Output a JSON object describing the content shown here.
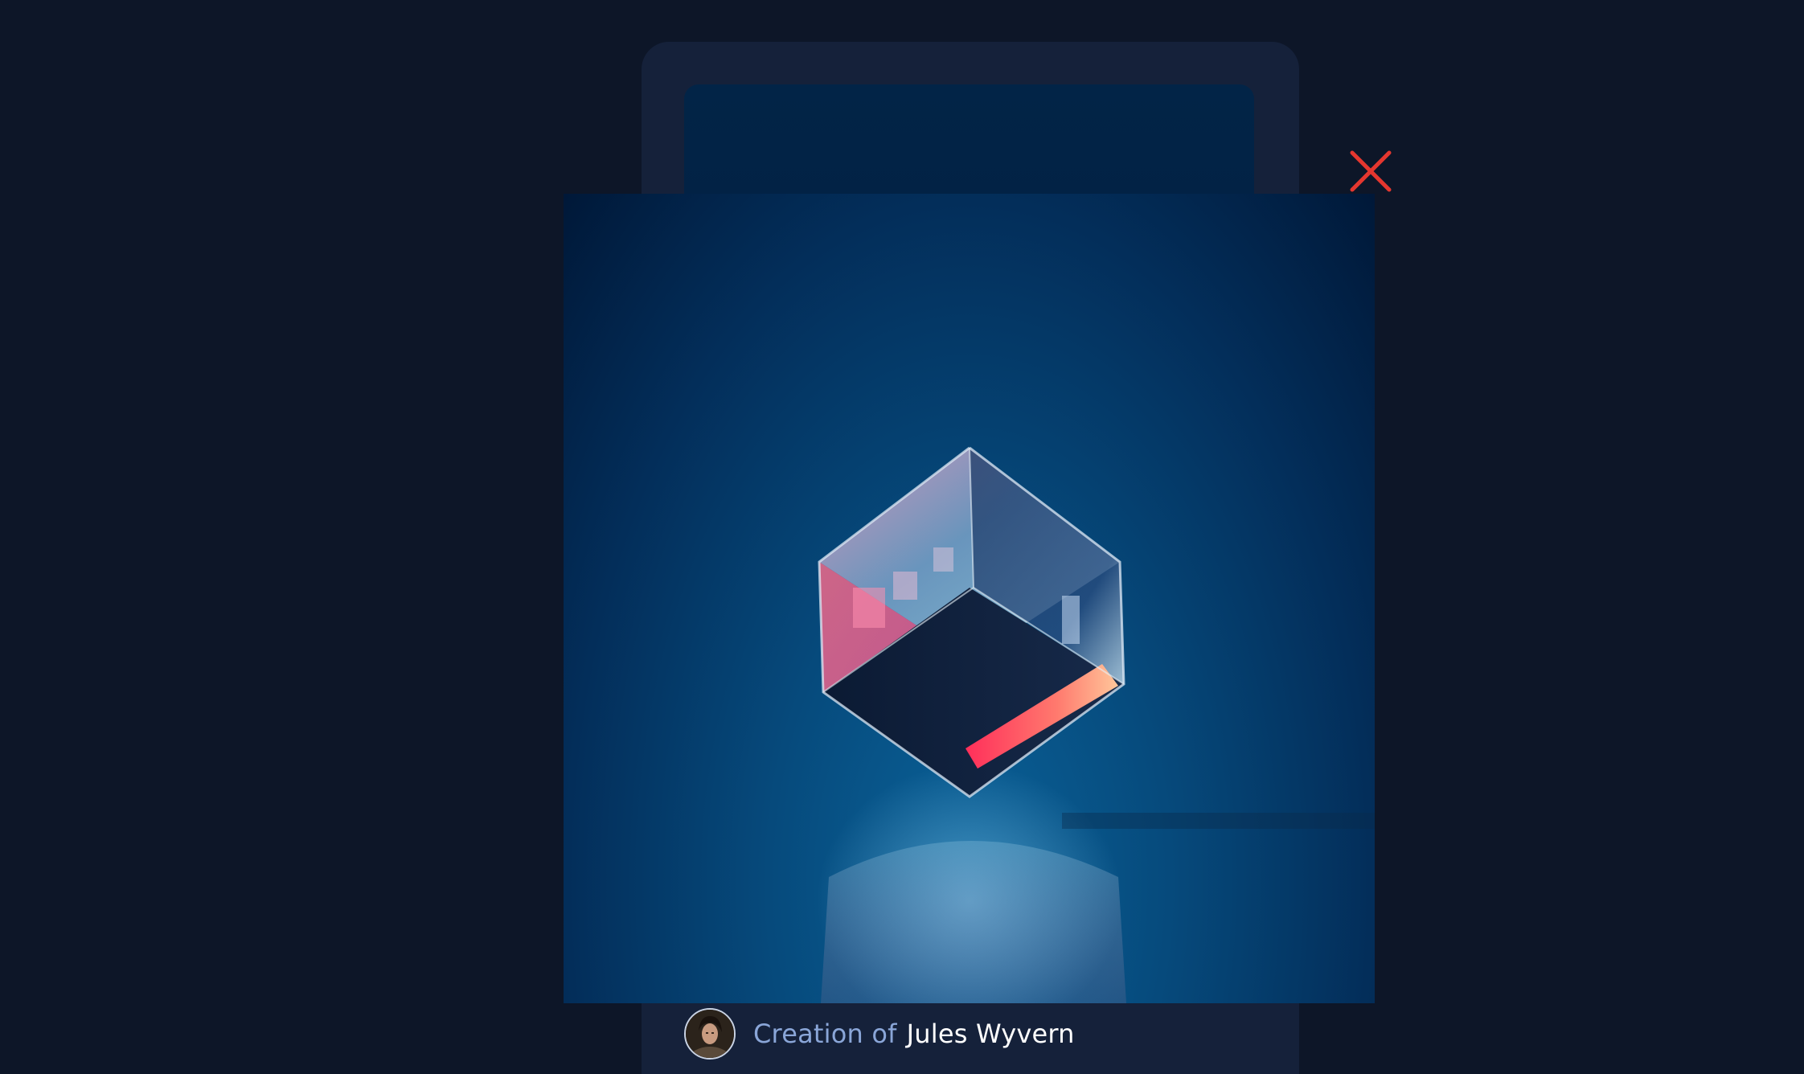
{
  "modal": {
    "close_icon": "close-icon",
    "close_color": "#e5372f",
    "image_subject": "glass-cube-photo"
  },
  "card": {
    "avatar_icon": "creator-avatar",
    "creation_label": "Creation of",
    "creator_name": "Jules Wyvern"
  },
  "colors": {
    "background": "#0d1628",
    "card": "#15213a",
    "label_accent": "#8aa6d8"
  }
}
